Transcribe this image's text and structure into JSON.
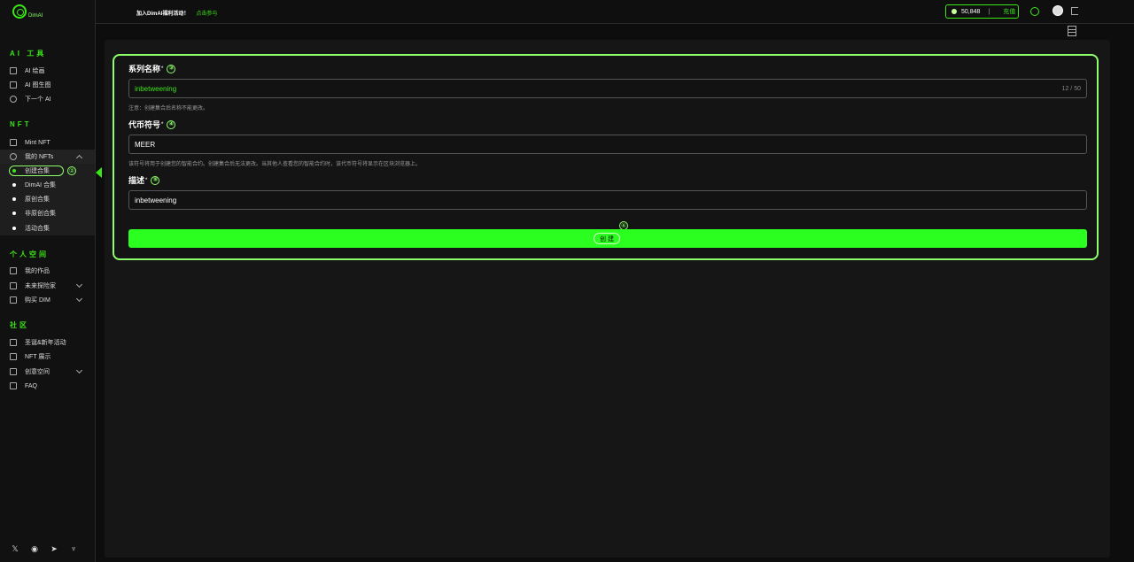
{
  "brand": {
    "name": "DimAI"
  },
  "sidebar": {
    "sections": {
      "ai_tools": "AI 工具",
      "nft": "NFT",
      "personal": "个人空间",
      "community": "社区"
    },
    "ai_items": [
      "AI 绘画",
      "AI 图生图",
      "下一个 AI"
    ],
    "nft_items": [
      "Mint NFT",
      "我的 NFTs"
    ],
    "nft_sub_items": [
      "创建合集",
      "DimAI 合集",
      "原创合集",
      "非原创合集",
      "活动合集"
    ],
    "personal_items": [
      "我的作品",
      "未来探险家",
      "购买 DIM"
    ],
    "community_items": [
      "圣诞&新年活动",
      "NFT 展示",
      "创意空间",
      "FAQ"
    ],
    "callout_2": "②"
  },
  "topbar": {
    "announcement": "加入DimAI福利活动！",
    "announcement_link": "点击参与",
    "balance": "50,848",
    "separator": "|",
    "recharge": "充值"
  },
  "form": {
    "name_label": "系列名称",
    "name_required": "*",
    "callout_3": "③",
    "name_value": "inbetweening",
    "name_count": "12 / 50",
    "name_hint": "注意：创建集合后名称不能更改。",
    "symbol_label": "代币符号",
    "symbol_required": "*",
    "callout_4": "④",
    "symbol_value": "MEER",
    "symbol_hint": "该符号将用于创建您的智能合约。创建集合后无法更改。当其他人查看您的智能合约时，该代币符号将显示在区块浏览器上。",
    "desc_label": "描述",
    "desc_required": "*",
    "callout_5": "⑤",
    "desc_value": "inbetweening",
    "callout_6": "⑥",
    "submit_label": "创 建"
  },
  "colors": {
    "accent": "#39e617",
    "highlight": "#8cff6b",
    "button": "#2bff1f"
  }
}
